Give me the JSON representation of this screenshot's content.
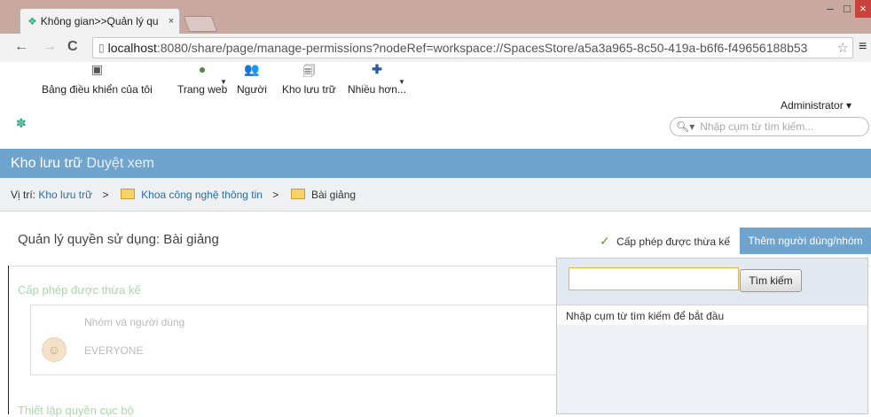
{
  "browser": {
    "tab_title": "Không gian>>Quản lý qu",
    "tab_close": "×",
    "url_host": "localhost",
    "url_rest": ":8080/share/page/manage-permissions?nodeRef=workspace://SpacesStore/a5a3a965-8c50-419a-b6f6-f49656188b53",
    "win_min": "–",
    "win_max": "□",
    "win_close": "×"
  },
  "header": {
    "nav": [
      {
        "label": "Bảng điều khiển của tôi",
        "icon": "dashboard-icon"
      },
      {
        "label": "Trang web",
        "icon": "globe-icon"
      },
      {
        "label": "Người",
        "icon": "people-icon"
      },
      {
        "label": "Kho lưu trữ",
        "icon": "repository-icon"
      },
      {
        "label": "Nhiều hơn...",
        "icon": "plus-icon"
      }
    ],
    "user": "Administrator ▾",
    "search_placeholder": "Nhập cụm từ tìm kiếm..."
  },
  "title": {
    "main": "Kho lưu trữ",
    "sub": "Duyệt xem"
  },
  "breadcrumb": {
    "prefix": "Vị trí:",
    "items": [
      "Kho lưu trữ",
      "Khoa công nghệ thông tin",
      "Bài giảng"
    ]
  },
  "page": {
    "title": "Quản lý quyền sử dụng: Bài giảng",
    "inherit_label": "Cấp phép được thừa kế",
    "add_button": "Thêm người dùng/nhóm"
  },
  "inherited": {
    "section_title": "Cấp phép được thừa kế",
    "column": "Nhóm và người dùng",
    "row": "EVERYONE"
  },
  "local": {
    "section_title": "Thiết lập quyền cục bộ"
  },
  "popup": {
    "button": "Tìm kiếm",
    "hint": "Nhập cụm từ tìm kiếm để bắt đầu"
  }
}
